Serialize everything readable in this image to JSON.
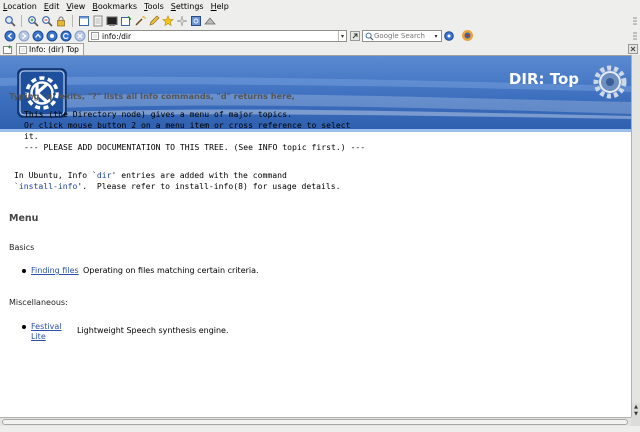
{
  "menubar": [
    "Location",
    "Edit",
    "View",
    "Bookmarks",
    "Tools",
    "Settings",
    "Help"
  ],
  "toolbar_icons": [
    "back-icon",
    "forward-icon",
    "up-icon",
    "reload-icon",
    "stop-icon",
    "home-icon",
    "zoom-in-icon",
    "zoom-out-icon",
    "bookmark-icon"
  ],
  "location": {
    "url": "info:/dir",
    "search_placeholder": "Google Search"
  },
  "tab": {
    "label": "Info: (dir) Top"
  },
  "page": {
    "banner_title": "DIR: Top",
    "hint": "Typing \"q\" exits, \"?\" lists all Info commands, \"d\" returns here,",
    "intro": "This (the Directory node) gives a menu of major topics.\nOr click mouse button 2 on a menu item or cross reference to select\nit.\n--- PLEASE ADD DOCUMENTATION TO THIS TREE. (See INFO topic first.) ---",
    "ubuntu_line1_prefix": "In Ubuntu, Info `",
    "ubuntu_code1": "dir",
    "ubuntu_line1_suffix": "' entries are added with the command",
    "ubuntu_code2": "`install-info",
    "ubuntu_line2_suffix": "'.  Please refer to install-info(8) for usage details.",
    "menu_heading": "Menu",
    "sections": [
      {
        "name": "Basics",
        "items": [
          {
            "link": "Finding files",
            "desc": "Operating on files matching certain criteria."
          }
        ]
      },
      {
        "name": "Miscellaneous:",
        "items": [
          {
            "link": "Festival Lite",
            "desc": "Lightweight Speech synthesis engine."
          }
        ]
      }
    ]
  },
  "colors": {
    "banner": "#3d6fbf",
    "link": "#2a50a8"
  }
}
